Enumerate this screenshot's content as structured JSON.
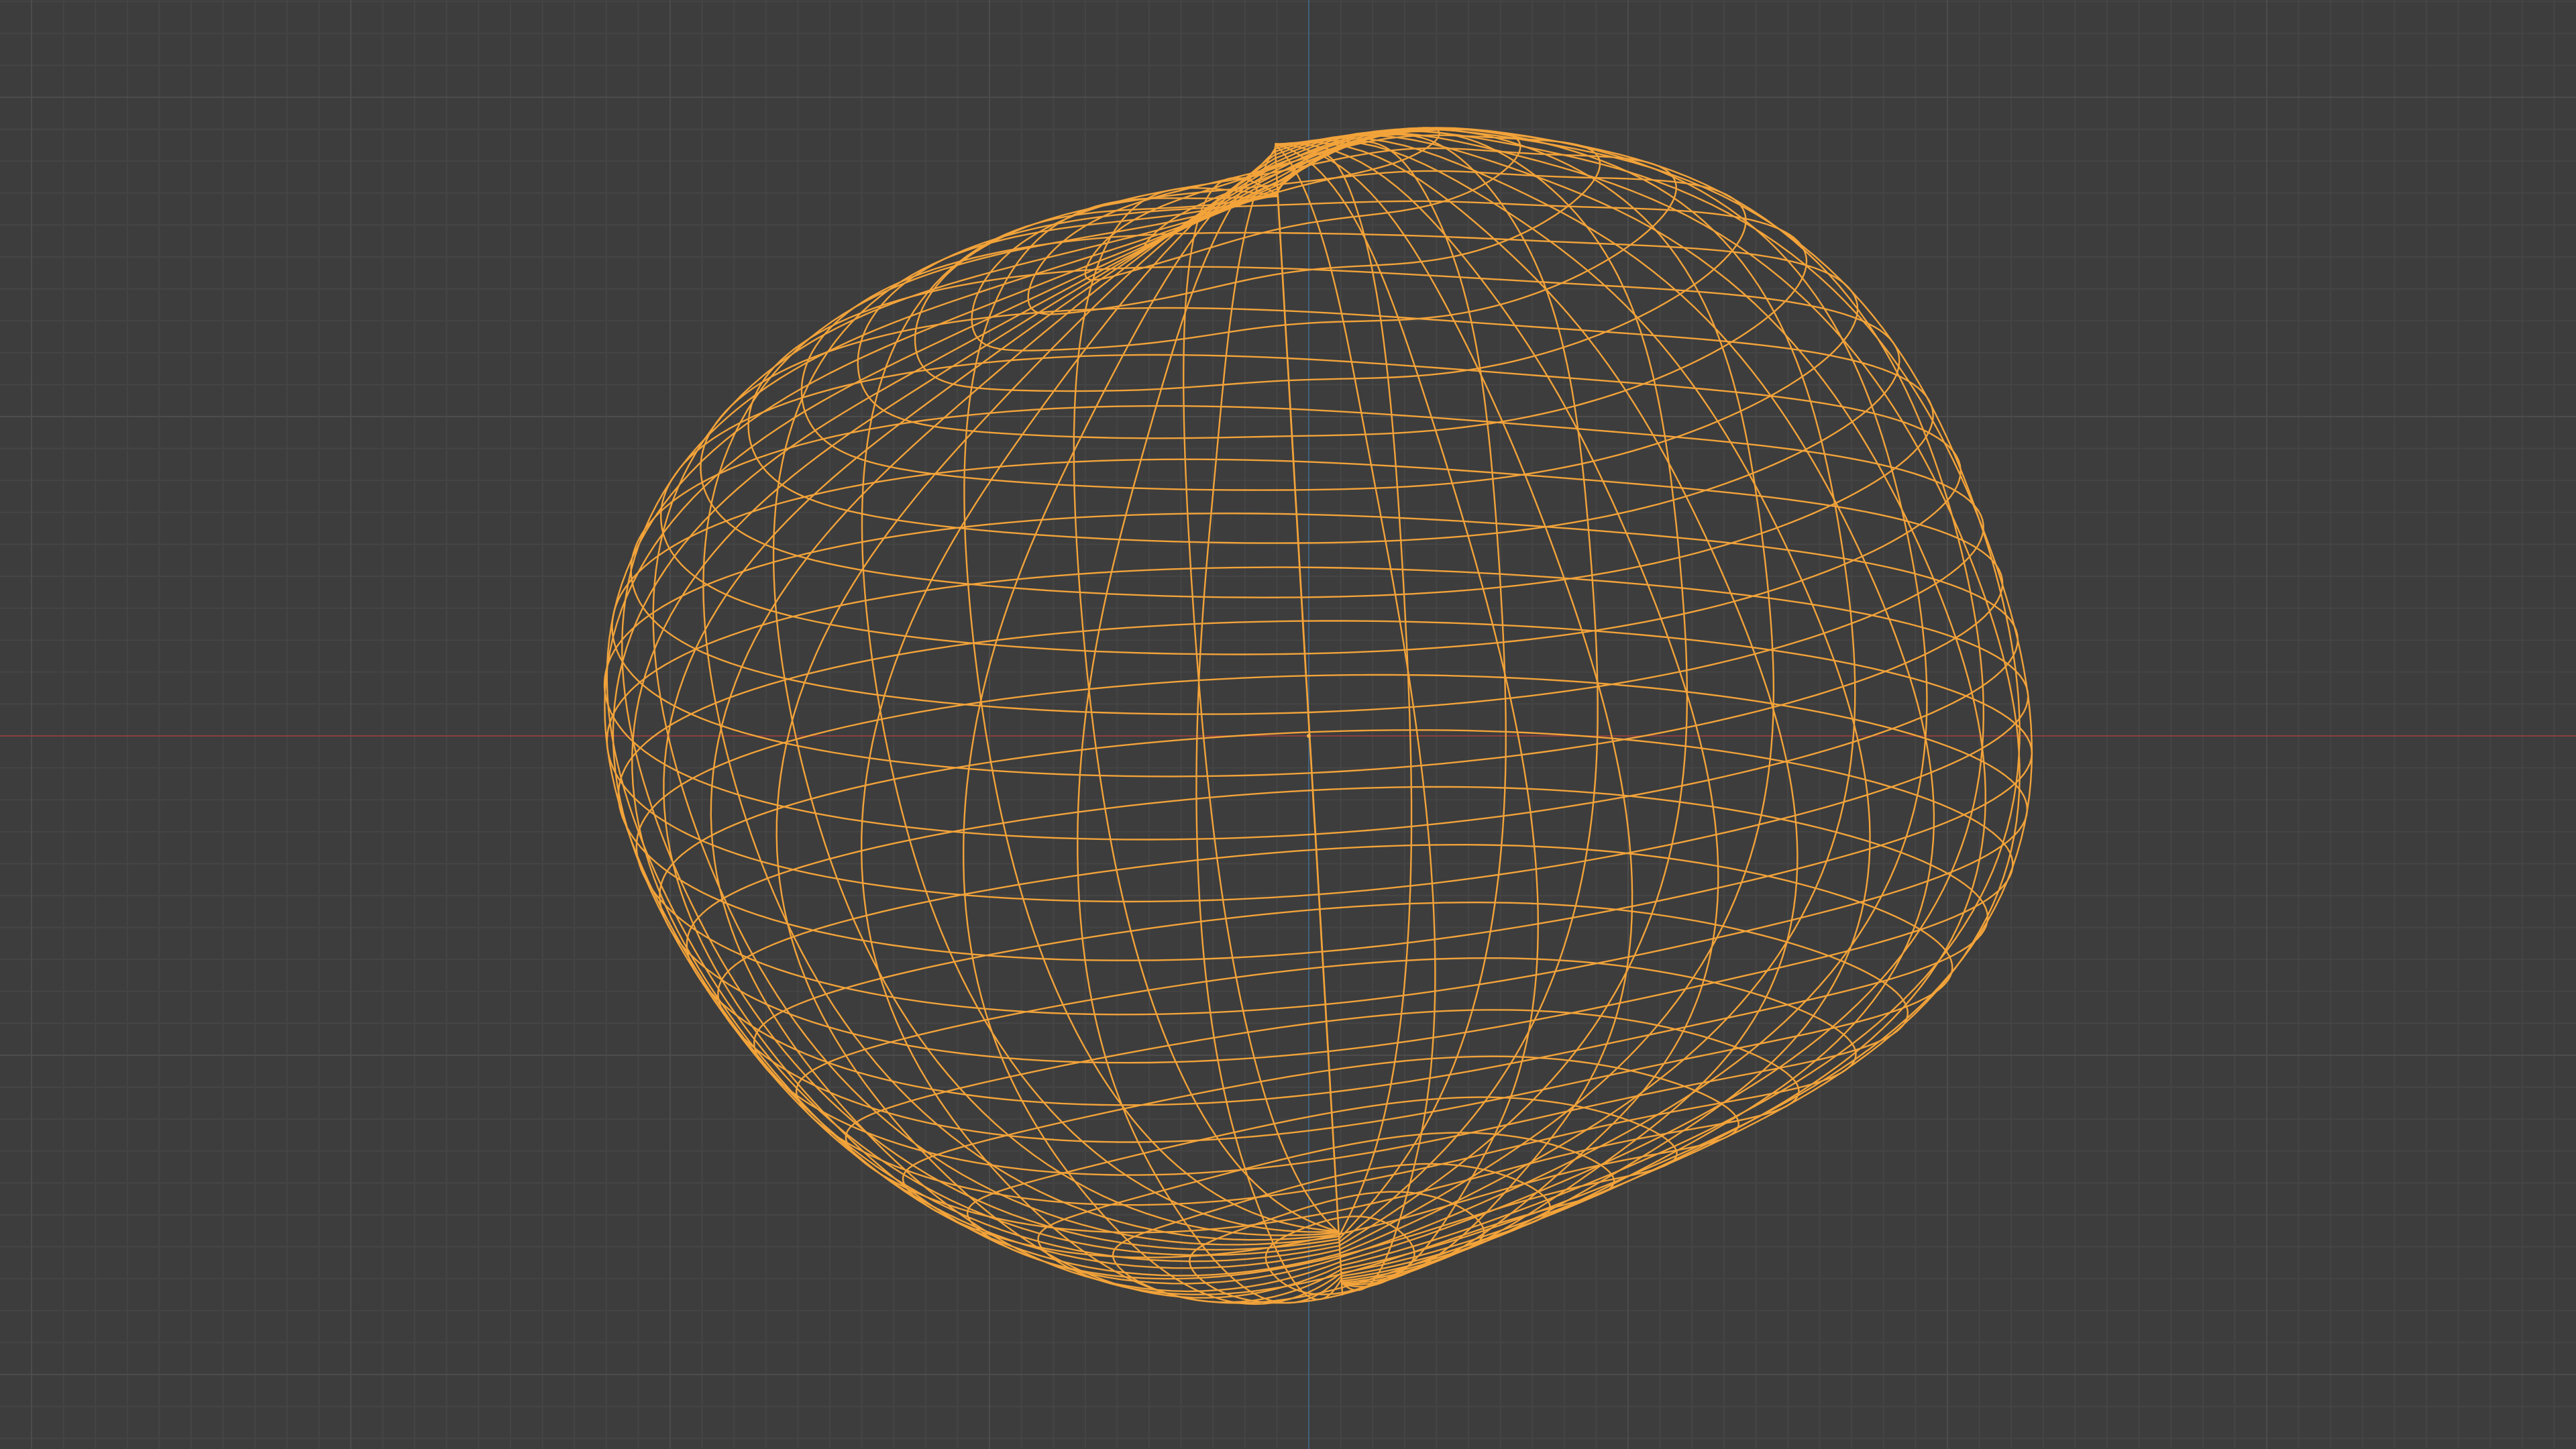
{
  "viewport": {
    "mode": "wireframe",
    "background_color": "#3d3d3d",
    "grid_minor_color": "#454545",
    "grid_major_color": "#4c4c4c",
    "x_axis_color": "#8a3f3f",
    "y_axis_color": "#3f607d",
    "wire_color": "#f2a33a",
    "origin_color": "#f5b04a",
    "object": {
      "shape": "deformed-sphere",
      "meridians": 40,
      "parallels": 30,
      "selected": true
    }
  }
}
